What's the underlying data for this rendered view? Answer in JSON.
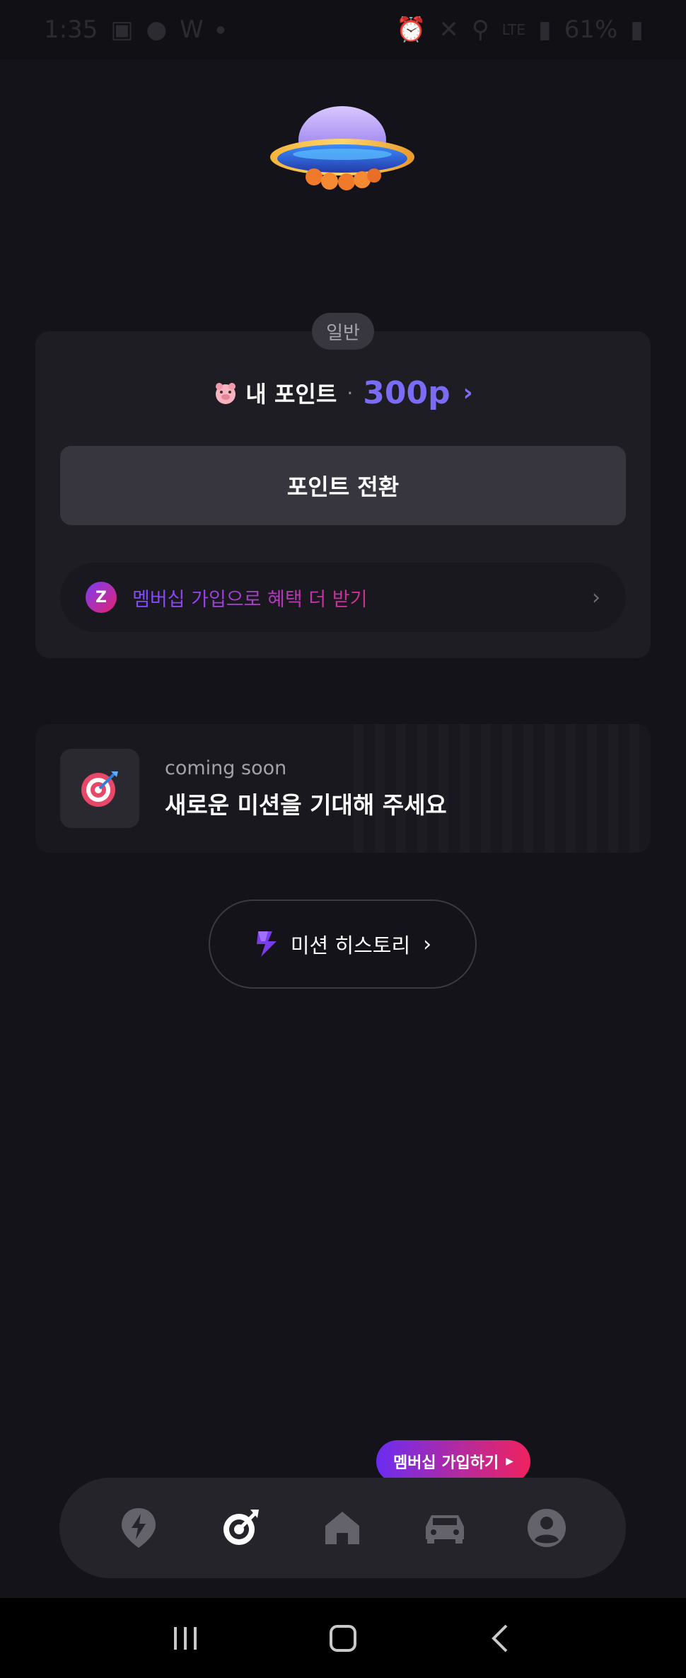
{
  "status_bar": {
    "time": "1:35",
    "notif_letter": "W",
    "battery": "61%",
    "network": "LTE"
  },
  "points_section": {
    "grade_badge": "일반",
    "points_label": "내 포인트",
    "separator": "·",
    "points_value": "300p",
    "convert_button": "포인트 전환",
    "membership_promo": "멤버십 가입으로 혜택 더 받기",
    "membership_logo_letter": "Z"
  },
  "mission_card": {
    "coming_soon": "coming soon",
    "title": "새로운 미션을 기대해 주세요"
  },
  "history_button": {
    "label": "미션 히스토리"
  },
  "tooltip": {
    "label": "멤버십 가입하기"
  },
  "bottom_nav": {
    "items": [
      {
        "icon": "bolt-pin-icon",
        "active": false
      },
      {
        "icon": "target-icon",
        "active": true
      },
      {
        "icon": "home-icon",
        "active": false
      },
      {
        "icon": "car-icon",
        "active": false
      },
      {
        "icon": "profile-icon",
        "active": false
      }
    ]
  },
  "colors": {
    "background": "#141319",
    "card": "#1e1d23",
    "accent_purple": "#7b6cf6",
    "accent_pink": "#f0225e"
  }
}
